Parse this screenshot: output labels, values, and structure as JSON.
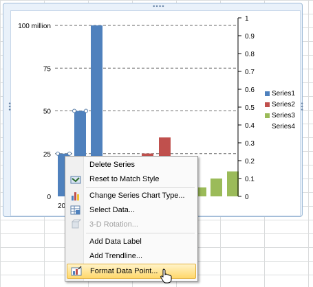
{
  "chart": {
    "left_axis_ticks": [
      "100 million",
      "75",
      "50",
      "25",
      "0"
    ],
    "right_axis_ticks": [
      "1",
      "0.9",
      "0.8",
      "0.7",
      "0.6",
      "0.5",
      "0.4",
      "0.3",
      "0.2",
      "0.1",
      "0"
    ],
    "x_label_partial": "20",
    "legend": [
      {
        "name": "Series1",
        "color": "#4f81bd"
      },
      {
        "name": "Series2",
        "color": "#c0504d"
      },
      {
        "name": "Series3",
        "color": "#9bbb59"
      },
      {
        "name": "Series4",
        "color": ""
      }
    ]
  },
  "chart_data": {
    "type": "bar",
    "ylim_left": [
      0,
      100
    ],
    "ylim_right": [
      0,
      1
    ],
    "grid": true,
    "legend_position": "right",
    "series": [
      {
        "name": "Series1",
        "axis": "left",
        "values": [
          25,
          50,
          100
        ]
      },
      {
        "name": "Series2",
        "axis": "right",
        "values": [
          0.24,
          0.33
        ]
      },
      {
        "name": "Series3",
        "axis": "right",
        "values": [
          0.05,
          0.1,
          0.14
        ]
      }
    ]
  },
  "context_menu": {
    "items": [
      {
        "label": "Delete Series",
        "icon": "none",
        "enabled": true
      },
      {
        "label": "Reset to Match Style",
        "icon": "reset-style-icon",
        "enabled": true
      },
      {
        "label": "Change Series Chart Type...",
        "icon": "chart-type-icon",
        "enabled": true
      },
      {
        "label": "Select Data...",
        "icon": "select-data-icon",
        "enabled": true
      },
      {
        "label": "3-D Rotation...",
        "icon": "rotation-3d-icon",
        "enabled": false
      },
      {
        "label": "Add Data Label",
        "icon": "none",
        "enabled": true
      },
      {
        "label": "Add Trendline...",
        "icon": "none",
        "enabled": true
      },
      {
        "label": "Format Data Point...",
        "icon": "format-point-icon",
        "enabled": true,
        "highlighted": true
      }
    ]
  }
}
